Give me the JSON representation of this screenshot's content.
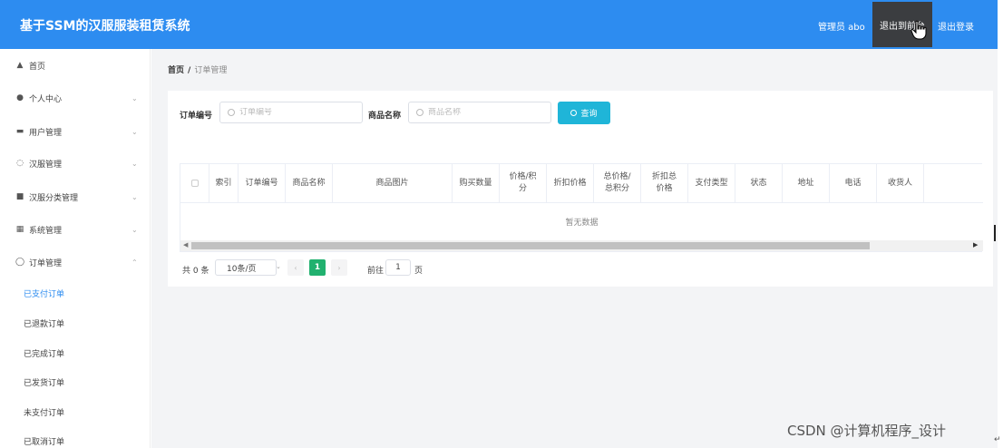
{
  "header": {
    "app_title": "基于SSM的汉服服装租赁系统",
    "admin_label": "管理员 abo",
    "front_button": "退出到前台",
    "logout_button": "退出登录"
  },
  "sidebar": {
    "items": [
      {
        "label": "首页",
        "icon": "home-icon",
        "expandable": false
      },
      {
        "label": "个人中心",
        "icon": "user-icon",
        "expandable": true
      },
      {
        "label": "用户管理",
        "icon": "users-icon",
        "expandable": true
      },
      {
        "label": "汉服管理",
        "icon": "hanfu-icon",
        "expandable": true
      },
      {
        "label": "汉服分类管理",
        "icon": "category-icon",
        "expandable": true
      },
      {
        "label": "系统管理",
        "icon": "grid-icon",
        "expandable": true
      },
      {
        "label": "订单管理",
        "icon": "order-icon",
        "expandable": true,
        "expanded": true
      }
    ],
    "sub_items": [
      {
        "label": "已支付订单",
        "active": true
      },
      {
        "label": "已退款订单"
      },
      {
        "label": "已完成订单"
      },
      {
        "label": "已发货订单"
      },
      {
        "label": "未支付订单"
      },
      {
        "label": "已取消订单"
      }
    ]
  },
  "breadcrumb": {
    "home": "首页",
    "separator": "/",
    "current": "订单管理"
  },
  "search": {
    "order_no_label": "订单编号",
    "order_no_placeholder": "订单编号",
    "order_no_value": "",
    "product_name_label": "商品名称",
    "product_name_placeholder": "商品名称",
    "product_name_value": "",
    "query_button": "查询"
  },
  "table": {
    "columns": [
      "",
      "索引",
      "订单编号",
      "商品名称",
      "商品图片",
      "购买数量",
      "价格/积分",
      "折扣价格",
      "总价格/总积分",
      "折扣总价格",
      "支付类型",
      "状态",
      "地址",
      "电话",
      "收货人"
    ],
    "empty_text": "暂无数据"
  },
  "pagination": {
    "total": "共 0 条",
    "page_size": "10条/页",
    "prev": "‹",
    "current_page": "1",
    "next": "›",
    "goto_label": "前往",
    "goto_value": "1",
    "page_suffix": "页"
  },
  "watermark": "CSDN @计算机程序_设计",
  "colors": {
    "header": "#2d8cf0",
    "query_button": "#1fb5d8",
    "active_page": "#21b16f",
    "active_menu": "#2d8cf0",
    "front_button": "#3b3d40"
  }
}
